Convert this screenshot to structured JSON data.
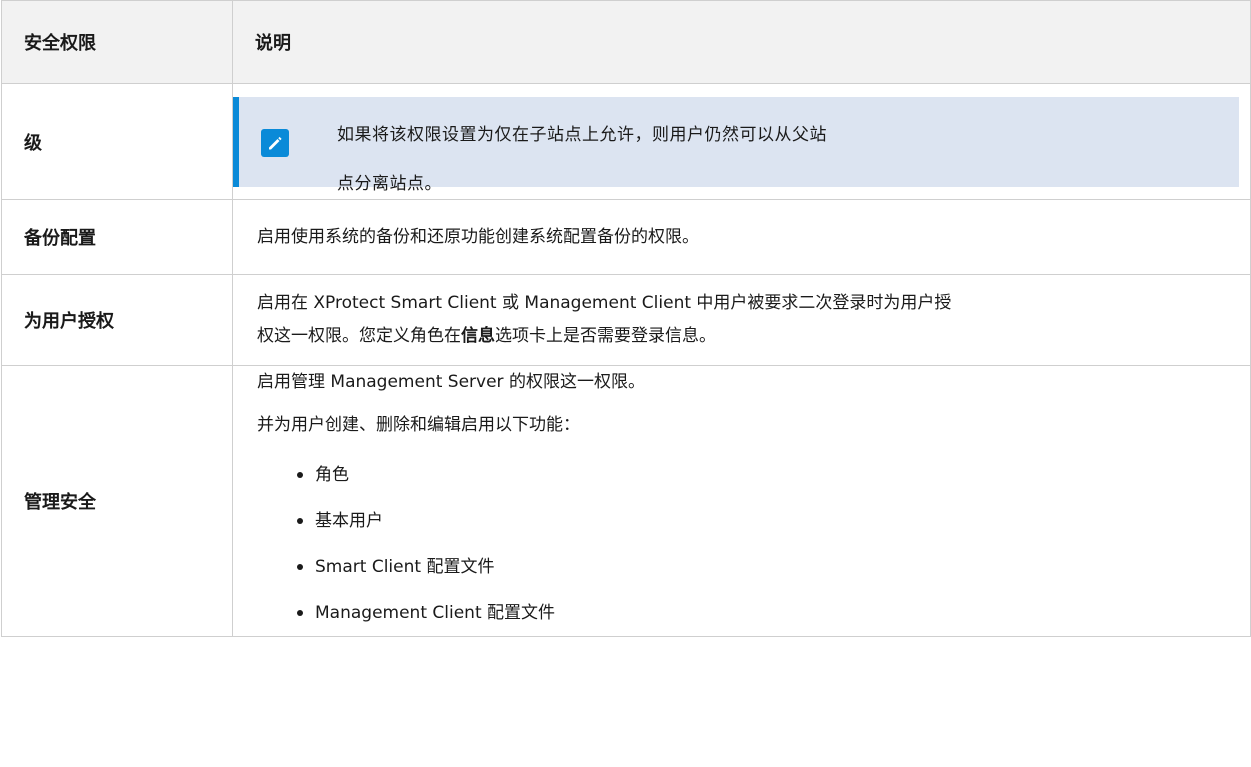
{
  "table": {
    "headers": [
      "安全权限",
      "说明"
    ],
    "rows": {
      "level": {
        "name": "级",
        "note_line1": "如果将该权限设置为仅在子站点上允许，则用户仍然可以从父站",
        "note_line2": "点分离站点。"
      },
      "backup": {
        "name": "备份配置",
        "desc": "启用使用系统的备份和还原功能创建系统配置备份的权限。"
      },
      "authorize": {
        "name": "为用户授权",
        "desc_line1": "启用在 XProtect Smart Client 或 Management Client 中用户被要求二次登录时为用户授",
        "desc_line2_pre": "权这一权限。您定义角色在",
        "desc_line2_bold": "信息",
        "desc_line2_post": "选项卡上是否需要登录信息。"
      },
      "manage_security": {
        "name": "管理安全",
        "desc1": "启用管理 Management Server 的权限这一权限。",
        "desc2": "并为用户创建、删除和编辑启用以下功能：",
        "items": [
          "角色",
          "基本用户",
          "Smart Client 配置文件",
          "Management Client 配置文件"
        ]
      }
    }
  },
  "colors": {
    "accent": "#0a8ad8",
    "note_bg": "#dce4f1",
    "header_bg": "#f2f2f2",
    "border": "#cfcfcf"
  },
  "icons": {
    "note": "pencil-icon"
  }
}
